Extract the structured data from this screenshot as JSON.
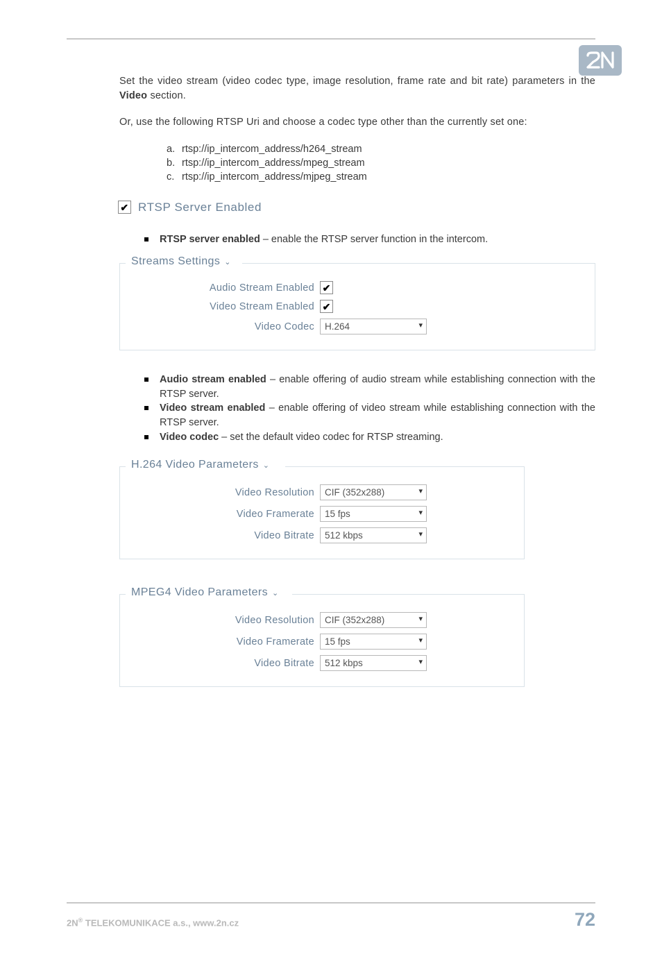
{
  "logo_text": "2N",
  "intro": {
    "p1_a": "Set the video stream (video codec type, image resolution, frame rate and bit rate) parameters in the ",
    "p1_b": "Video",
    "p1_c": " section.",
    "p2": "Or, use the following RTSP Uri and choose a codec type other than the currently set one:"
  },
  "uri_list": [
    "rtsp://ip_intercom_address/h264_stream",
    "rtsp://ip_intercom_address/mpeg_stream",
    "rtsp://ip_intercom_address/mjpeg_stream"
  ],
  "rtsp_checkbox_label": "RTSP Server Enabled",
  "rtsp_bullet": {
    "strong": "RTSP server enabled",
    "rest": " – enable the RTSP server function in the intercom."
  },
  "streams_fieldset": {
    "legend": "Streams Settings",
    "rows": {
      "audio_label": "Audio Stream Enabled",
      "video_label": "Video Stream Enabled",
      "codec_label": "Video Codec",
      "codec_value": "H.264"
    }
  },
  "streams_bullets": [
    {
      "strong": "Audio stream enabled",
      "rest": " – enable offering of audio stream while establishing connection with the RTSP server."
    },
    {
      "strong": "Video stream enabled",
      "rest": " –  enable offering of video stream while establishing connection with the RTSP server."
    },
    {
      "strong": "Video codec",
      "rest": " – set the default video codec for RTSP streaming."
    }
  ],
  "h264_fieldset": {
    "legend": "H.264 Video Parameters",
    "res_label": "Video Resolution",
    "res_value": "CIF (352x288)",
    "fps_label": "Video Framerate",
    "fps_value": "15 fps",
    "br_label": "Video Bitrate",
    "br_value": "512 kbps"
  },
  "mpeg4_fieldset": {
    "legend": "MPEG4 Video Parameters",
    "res_label": "Video Resolution",
    "res_value": "CIF (352x288)",
    "fps_label": "Video Framerate",
    "fps_value": "15 fps",
    "br_label": "Video Bitrate",
    "br_value": "512 kbps"
  },
  "footer": {
    "company_prefix": "2N",
    "company_reg": "®",
    "company_rest": " TELEKOMUNIKACE a.s., www.2n.cz",
    "page_number": "72"
  }
}
